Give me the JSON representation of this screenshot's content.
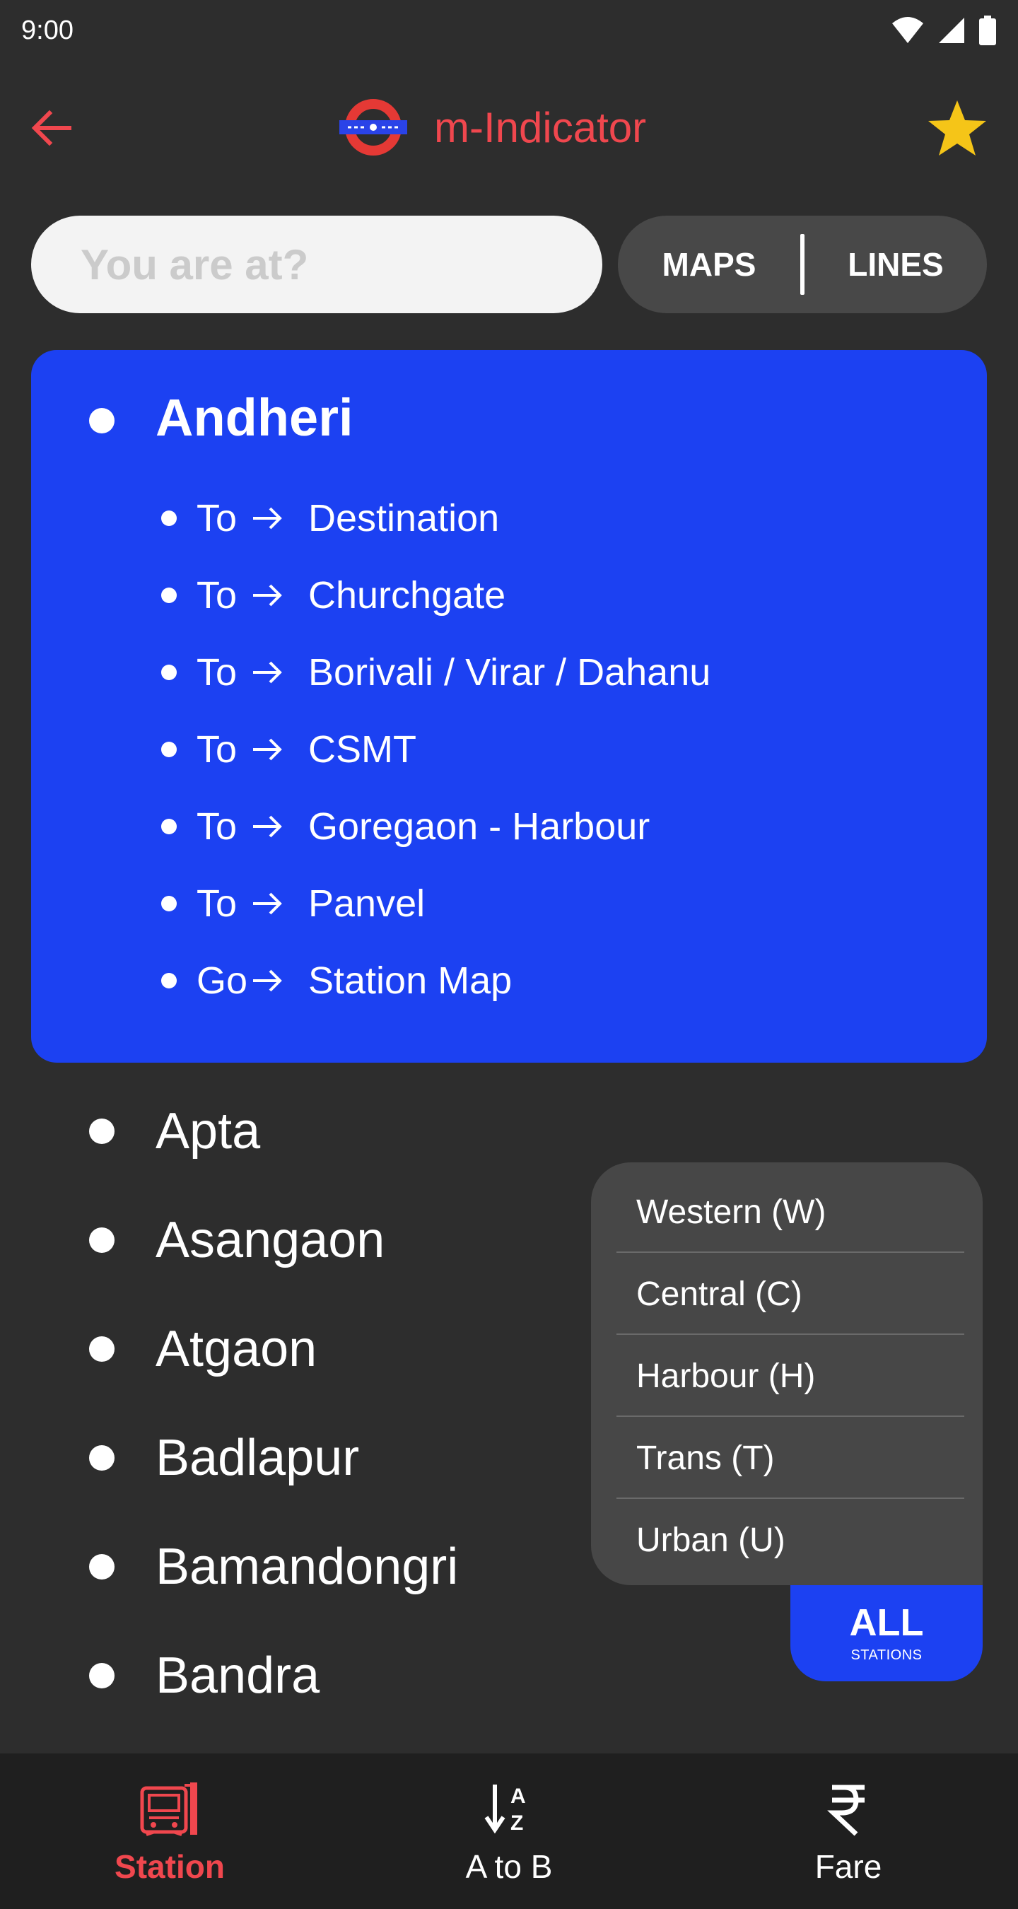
{
  "status_bar": {
    "time": "9:00"
  },
  "header": {
    "title": "m-Indicator"
  },
  "search": {
    "placeholder": "You are at?"
  },
  "segment": {
    "maps": "MAPS",
    "lines": "LINES"
  },
  "selected_station": {
    "name": "Andheri",
    "routes": [
      {
        "prefix": "To",
        "dest": "Destination"
      },
      {
        "prefix": "To",
        "dest": "Churchgate"
      },
      {
        "prefix": "To",
        "dest": "Borivali / Virar / Dahanu"
      },
      {
        "prefix": "To",
        "dest": "CSMT"
      },
      {
        "prefix": "To",
        "dest": "Goregaon - Harbour"
      },
      {
        "prefix": "To",
        "dest": "Panvel"
      },
      {
        "prefix": "Go",
        "dest": "Station Map"
      }
    ]
  },
  "stations": [
    "Apta",
    "Asangaon",
    "Atgaon",
    "Badlapur",
    "Bamandongri",
    "Bandra"
  ],
  "filter_menu": {
    "items": [
      "Western (W)",
      "Central (C)",
      "Harbour (H)",
      "Trans (T)",
      "Urban (U)"
    ],
    "all_label": "ALL",
    "all_sublabel": "STATIONS"
  },
  "bottom_nav": {
    "items": [
      {
        "label": "Station",
        "icon": "train-icon",
        "active": true
      },
      {
        "label": "A to B",
        "icon": "sort-az-icon",
        "active": false
      },
      {
        "label": "Fare",
        "icon": "rupee-icon",
        "active": false
      }
    ]
  },
  "colors": {
    "accent": "#f0474e",
    "card": "#1c41f2",
    "background": "#2d2d2d",
    "star": "#f5c518"
  }
}
